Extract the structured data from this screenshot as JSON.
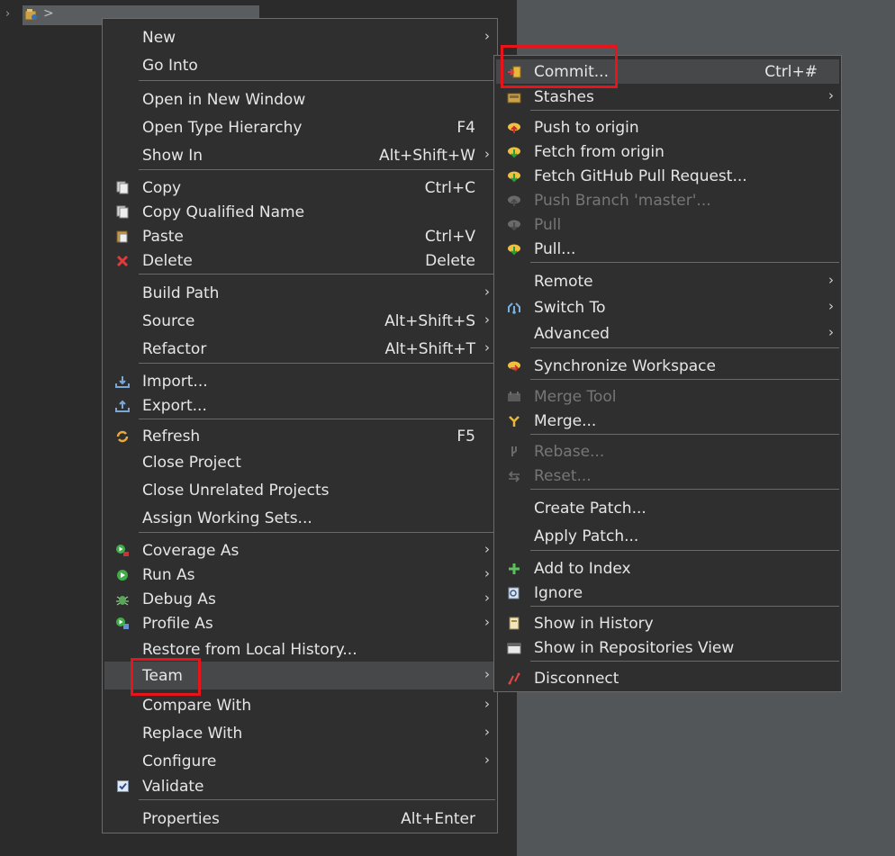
{
  "colors": {
    "accent_red": "#e8141c",
    "menu_bg": "#2f2f2f",
    "highlight": "#474849"
  },
  "main_menu": {
    "items": [
      {
        "label": "New",
        "shortcut": "",
        "submenu": true
      },
      {
        "label": "Go Into",
        "shortcut": ""
      },
      {
        "label": "Open in New Window",
        "shortcut": ""
      },
      {
        "label": "Open Type Hierarchy",
        "shortcut": "F4"
      },
      {
        "label": "Show In",
        "shortcut": "Alt+Shift+W",
        "submenu": true
      },
      {
        "label": "Copy",
        "shortcut": "Ctrl+C",
        "icon": "copy-icon"
      },
      {
        "label": "Copy Qualified Name",
        "shortcut": "",
        "icon": "copy-qualified-icon"
      },
      {
        "label": "Paste",
        "shortcut": "Ctrl+V",
        "icon": "paste-icon"
      },
      {
        "label": "Delete",
        "shortcut": "Delete",
        "icon": "delete-icon"
      },
      {
        "label": "Build Path",
        "shortcut": "",
        "submenu": true
      },
      {
        "label": "Source",
        "shortcut": "Alt+Shift+S",
        "submenu": true
      },
      {
        "label": "Refactor",
        "shortcut": "Alt+Shift+T",
        "submenu": true
      },
      {
        "label": "Import...",
        "shortcut": "",
        "icon": "import-icon"
      },
      {
        "label": "Export...",
        "shortcut": "",
        "icon": "export-icon"
      },
      {
        "label": "Refresh",
        "shortcut": "F5",
        "icon": "refresh-icon"
      },
      {
        "label": "Close Project",
        "shortcut": ""
      },
      {
        "label": "Close Unrelated Projects",
        "shortcut": ""
      },
      {
        "label": "Assign Working Sets...",
        "shortcut": ""
      },
      {
        "label": "Coverage As",
        "shortcut": "",
        "submenu": true,
        "icon": "coverage-icon"
      },
      {
        "label": "Run As",
        "shortcut": "",
        "submenu": true,
        "icon": "run-icon"
      },
      {
        "label": "Debug As",
        "shortcut": "",
        "submenu": true,
        "icon": "debug-icon"
      },
      {
        "label": "Profile As",
        "shortcut": "",
        "submenu": true,
        "icon": "profile-icon"
      },
      {
        "label": "Restore from Local History...",
        "shortcut": ""
      },
      {
        "label": "Team",
        "shortcut": "",
        "submenu": true
      },
      {
        "label": "Compare With",
        "shortcut": "",
        "submenu": true
      },
      {
        "label": "Replace With",
        "shortcut": "",
        "submenu": true
      },
      {
        "label": "Configure",
        "shortcut": "",
        "submenu": true
      },
      {
        "label": "Validate",
        "shortcut": "",
        "icon": "checkbox-icon"
      },
      {
        "label": "Properties",
        "shortcut": "Alt+Enter"
      }
    ]
  },
  "team_menu": {
    "items": [
      {
        "label": "Commit...",
        "shortcut": "Ctrl+#",
        "icon": "commit-icon"
      },
      {
        "label": "Stashes",
        "shortcut": "",
        "submenu": true,
        "icon": "stash-icon"
      },
      {
        "label": "Push to origin",
        "shortcut": "",
        "icon": "push-icon"
      },
      {
        "label": "Fetch from origin",
        "shortcut": "",
        "icon": "fetch-icon"
      },
      {
        "label": "Fetch GitHub Pull Request...",
        "shortcut": "",
        "icon": "fetch-pr-icon"
      },
      {
        "label": "Push Branch 'master'...",
        "shortcut": "",
        "icon": "push-branch-icon",
        "disabled": true
      },
      {
        "label": "Pull",
        "shortcut": "",
        "icon": "pull-icon",
        "disabled": true
      },
      {
        "label": "Pull...",
        "shortcut": "",
        "icon": "pull-dialog-icon"
      },
      {
        "label": "Remote",
        "shortcut": "",
        "submenu": true
      },
      {
        "label": "Switch To",
        "shortcut": "",
        "submenu": true,
        "icon": "switch-icon"
      },
      {
        "label": "Advanced",
        "shortcut": "",
        "submenu": true
      },
      {
        "label": "Synchronize Workspace",
        "shortcut": "",
        "icon": "sync-icon"
      },
      {
        "label": "Merge Tool",
        "shortcut": "",
        "icon": "merge-tool-icon",
        "disabled": true
      },
      {
        "label": "Merge...",
        "shortcut": "",
        "icon": "merge-icon"
      },
      {
        "label": "Rebase...",
        "shortcut": "",
        "icon": "rebase-icon",
        "disabled": true
      },
      {
        "label": "Reset...",
        "shortcut": "",
        "icon": "reset-icon",
        "disabled": true
      },
      {
        "label": "Create Patch...",
        "shortcut": ""
      },
      {
        "label": "Apply Patch...",
        "shortcut": ""
      },
      {
        "label": "Add to Index",
        "shortcut": "",
        "icon": "add-index-icon"
      },
      {
        "label": "Ignore",
        "shortcut": "",
        "icon": "ignore-icon"
      },
      {
        "label": "Show in History",
        "shortcut": "",
        "icon": "history-icon"
      },
      {
        "label": "Show in Repositories View",
        "shortcut": "",
        "icon": "repo-view-icon"
      },
      {
        "label": "Disconnect",
        "shortcut": "",
        "icon": "disconnect-icon"
      }
    ]
  }
}
